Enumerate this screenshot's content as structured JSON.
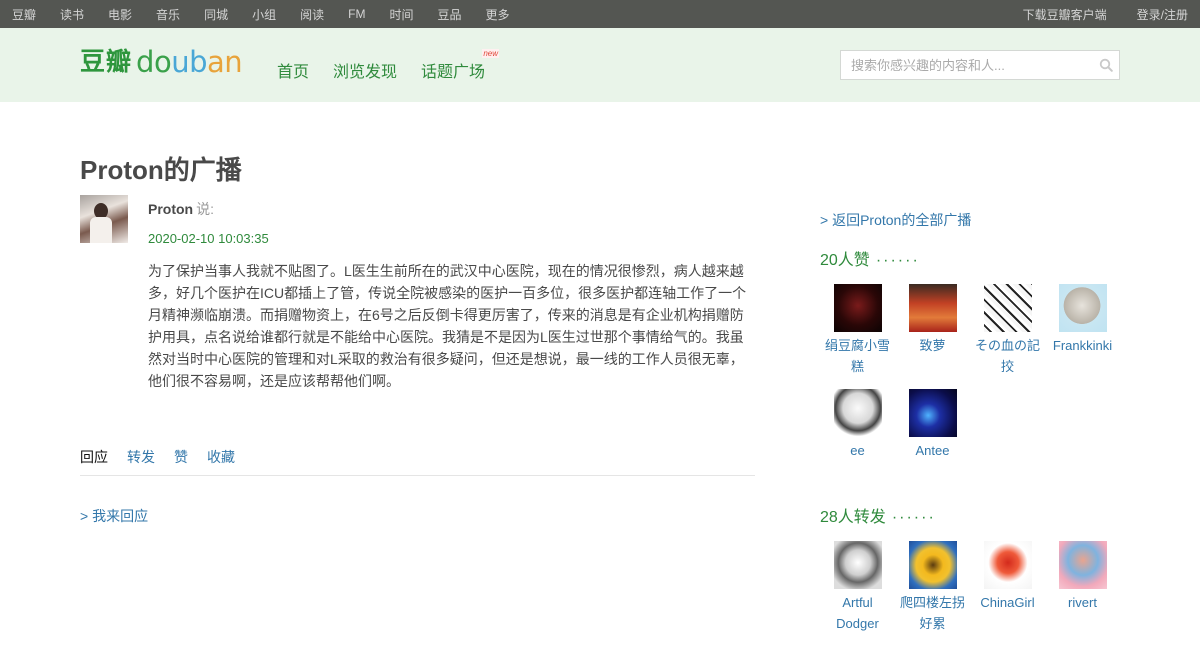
{
  "global_nav": {
    "left": [
      "豆瓣",
      "读书",
      "电影",
      "音乐",
      "同城",
      "小组",
      "阅读",
      "FM",
      "时间",
      "豆品",
      "更多"
    ],
    "right": [
      "下载豆瓣客户端",
      "登录/注册"
    ]
  },
  "header": {
    "logo_cn": "豆瓣",
    "logo_en": [
      "d",
      "o",
      "u",
      "b",
      "a",
      "n"
    ],
    "nav": [
      {
        "label": "首页"
      },
      {
        "label": "浏览发现"
      },
      {
        "label": "话题广场",
        "badge": "new"
      }
    ],
    "search_placeholder": "搜索你感兴趣的内容和人..."
  },
  "page_title": "Proton的广播",
  "status": {
    "author": "Proton",
    "say": "说:",
    "time": "2020-02-10 10:03:35",
    "text": "为了保护当事人我就不贴图了。L医生生前所在的武汉中心医院，现在的情况很惨烈，病人越来越多，好几个医护在ICU都插上了管，传说全院被感染的医护一百多位，很多医护都连轴工作了一个月精神濒临崩溃。而捐赠物资上，在6号之后反倒卡得更厉害了，传来的消息是有企业机构捐赠防护用具，点名说给谁都行就是不能给中心医院。我猜是不是因为L医生过世那个事情给气的。我虽然对当时中心医院的管理和对L采取的救治有很多疑问，但还是想说，最一线的工作人员很无辜，他们很不容易啊，还是应该帮帮他们啊。"
  },
  "actions": [
    "回应",
    "转发",
    "赞",
    "收藏"
  ],
  "reply_link": "> 我来回应",
  "aside": {
    "back_link": "> 返回Proton的全部广播",
    "likes_title": "20人赞",
    "likes_dots": "······",
    "likers": [
      "绢豆腐小雪糕",
      "致萝",
      "その血の記挍",
      "Frankkinki",
      "ee",
      "Antee"
    ],
    "reshares_title": "28人转发",
    "reshares_dots": "······",
    "resharers": [
      "Artful Dodger",
      "爬四楼左拐好累",
      "ChinaGirl",
      "rivert"
    ]
  },
  "colors": {
    "global_nav_bg": "#545652",
    "header_bg": "#e9f4e9",
    "green": "#2f8a3c",
    "link": "#3377aa"
  }
}
